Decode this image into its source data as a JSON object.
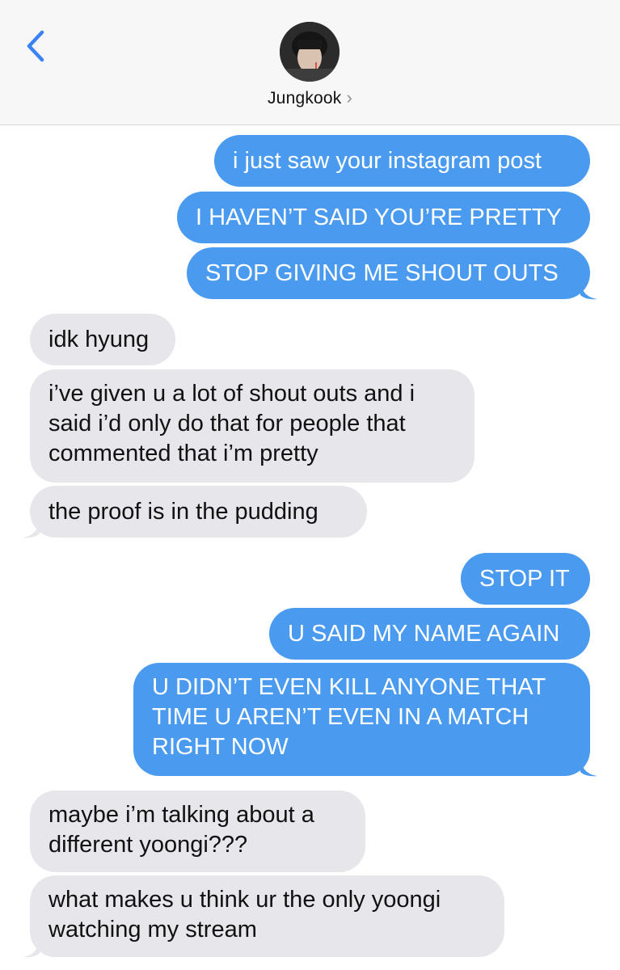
{
  "header": {
    "contact_name": "Jungkook",
    "chevron": "›",
    "back_icon": "chevron-left-icon"
  },
  "colors": {
    "outgoing_bubble": "#4a9bf0",
    "incoming_bubble": "#e6e6eb",
    "accent": "#3b82f6"
  },
  "messages": [
    {
      "from": "me",
      "lines": [
        "i just saw your instagram post"
      ]
    },
    {
      "from": "me",
      "lines": [
        "I HAVEN’T SAID YOU’RE PRETTY"
      ]
    },
    {
      "from": "me",
      "lines": [
        "STOP GIVING ME SHOUT OUTS"
      ]
    },
    {
      "from": "them",
      "lines": [
        "idk hyung"
      ]
    },
    {
      "from": "them",
      "lines": [
        "i’ve given u a lot of shout outs and i",
        "said i’d only do that for people that",
        "commented that i’m pretty"
      ]
    },
    {
      "from": "them",
      "lines": [
        "the proof is in the pudding"
      ]
    },
    {
      "from": "me",
      "lines": [
        "STOP IT"
      ]
    },
    {
      "from": "me",
      "lines": [
        "U SAID MY NAME AGAIN"
      ]
    },
    {
      "from": "me",
      "lines": [
        "U DIDN’T EVEN KILL ANYONE THAT",
        "TIME U AREN’T EVEN IN A MATCH",
        "RIGHT NOW"
      ]
    },
    {
      "from": "them",
      "lines": [
        "maybe i’m talking about a",
        "different yoongi???"
      ]
    },
    {
      "from": "them",
      "lines": [
        "what makes u think ur the only yoongi",
        "watching my stream"
      ]
    }
  ]
}
